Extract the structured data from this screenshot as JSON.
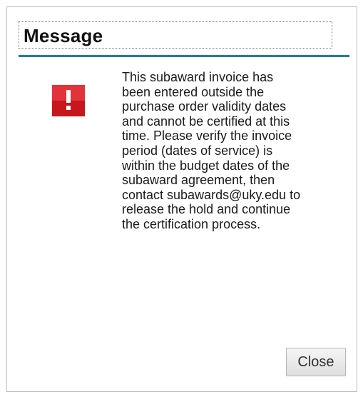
{
  "dialog": {
    "title": "Message",
    "message": "This subaward invoice has\nbeen entered outside the\npurchase order validity dates\nand cannot be certified at this\ntime. Please verify the invoice\nperiod (dates of service) is\nwithin the budget dates of the\nsubaward agreement, then\ncontact subawards@uky.edu to\nrelease the hold and continue\nthe certification process.",
    "icon": "exclamation-alert-icon",
    "close_label": "Close"
  },
  "colors": {
    "accent_line": "#1f7fa6",
    "alert_red": "#c8161d"
  }
}
